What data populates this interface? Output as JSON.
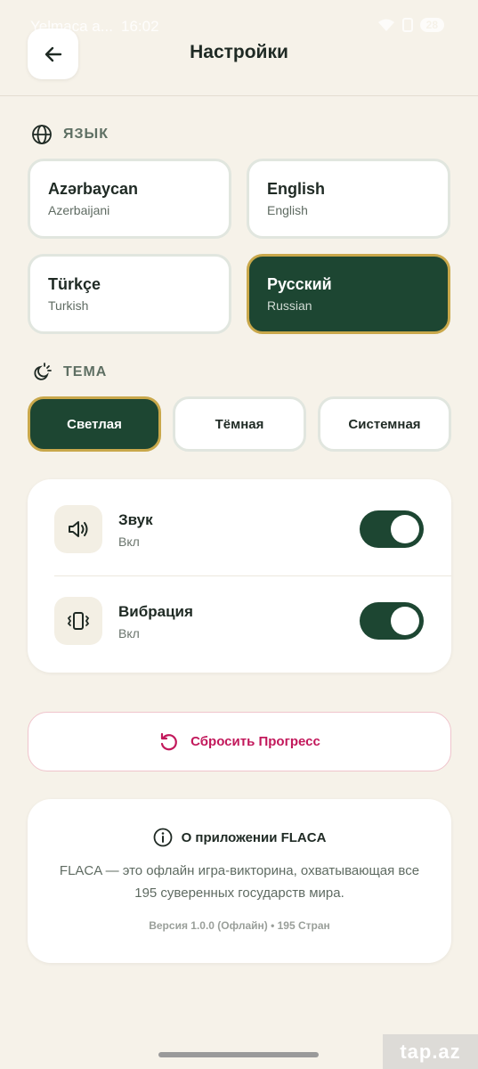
{
  "status_bar": {
    "carrier": "Yelmaca a...",
    "time": "16:02",
    "battery": "28"
  },
  "header": {
    "title": "Настройки",
    "back_icon": "arrow-left-icon"
  },
  "language_section": {
    "label": "ЯЗЫК",
    "options": [
      {
        "native": "Azərbaycan",
        "english": "Azerbaijani",
        "selected": false
      },
      {
        "native": "English",
        "english": "English",
        "selected": false
      },
      {
        "native": "Türkçe",
        "english": "Turkish",
        "selected": false
      },
      {
        "native": "Русский",
        "english": "Russian",
        "selected": true
      }
    ]
  },
  "theme_section": {
    "label": "ТЕМА",
    "options": [
      {
        "label": "Светлая",
        "selected": true
      },
      {
        "label": "Тёмная",
        "selected": false
      },
      {
        "label": "Системная",
        "selected": false
      }
    ]
  },
  "settings": [
    {
      "title": "Звук",
      "status": "Вкл",
      "icon": "speaker-icon",
      "enabled": true
    },
    {
      "title": "Вибрация",
      "status": "Вкл",
      "icon": "vibration-icon",
      "enabled": true
    }
  ],
  "reset": {
    "label": "Сбросить Прогресс",
    "icon": "reset-icon"
  },
  "about": {
    "title": "О приложении FLACA",
    "description": "FLACA — это офлайн игра-викторина, охватывающая все 195 суверенных государств мира.",
    "version": "Версия 1.0.0 (Офлайн) • 195 Стран"
  },
  "watermark": "tap.az",
  "colors": {
    "background": "#f6f2e9",
    "primary": "#1d4632",
    "accent_border": "#c9a84b",
    "danger": "#c2185b"
  }
}
